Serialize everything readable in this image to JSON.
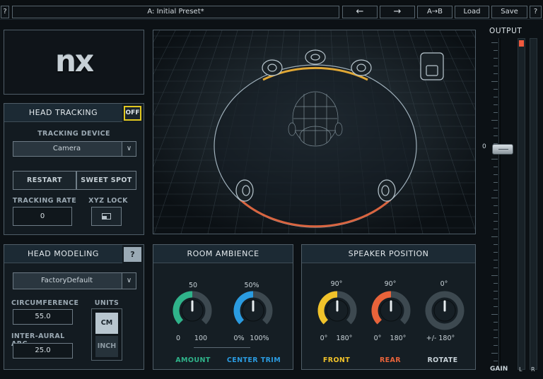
{
  "topbar": {
    "help": "?",
    "preset": "A: Initial Preset*",
    "prev": "←",
    "next": "→",
    "compare": "A→B",
    "load": "Load",
    "save": "Save",
    "help2": "?"
  },
  "logo": {
    "text": "nx"
  },
  "head_tracking": {
    "title": "HEAD TRACKING",
    "toggle": "OFF",
    "device_label": "TRACKING DEVICE",
    "device_value": "Camera",
    "restart": "RESTART",
    "sweet_spot": "SWEET SPOT",
    "rate_label": "TRACKING RATE",
    "rate_value": "0",
    "xyz_label": "XYZ LOCK"
  },
  "head_modeling": {
    "title": "HEAD MODELING",
    "help": "?",
    "preset_value": "FactoryDefault",
    "circumference_label": "CIRCUMFERENCE",
    "circumference_value": "55.0",
    "arc_label": "INTER-AURAL ARC",
    "arc_value": "25.0",
    "units_label": "UNITS",
    "unit_cm": "CM",
    "unit_inch": "INCH"
  },
  "room_ambience": {
    "title": "ROOM AMBIENCE",
    "amount": {
      "value": "50",
      "min": "0",
      "max": "100",
      "name": "AMOUNT",
      "fraction": 0.5,
      "color": "#2fb38a"
    },
    "center_trim": {
      "value": "50%",
      "min": "0%",
      "max": "100%",
      "name": "CENTER TRIM",
      "fraction": 0.5,
      "color": "#2a9be0"
    }
  },
  "speaker_position": {
    "title": "SPEAKER POSITION",
    "front": {
      "value": "90°",
      "min": "0°",
      "max": "180°",
      "name": "FRONT",
      "fraction": 0.5,
      "color": "#f0c22a"
    },
    "rear": {
      "value": "90°",
      "min": "0°",
      "max": "180°",
      "name": "REAR",
      "fraction": 0.5,
      "color": "#e8633a"
    },
    "rotate": {
      "value": "0°",
      "range": "+/- 180°",
      "name": "ROTATE",
      "fraction": 0.0
    }
  },
  "output": {
    "title": "OUTPUT",
    "zero": "0",
    "gain": "GAIN",
    "left": "L",
    "right": "R",
    "gain_db": 0
  },
  "colors": {
    "front_arc": "#e0a735",
    "rear_arc": "#d9643f",
    "highlight": "#e3c81f"
  }
}
